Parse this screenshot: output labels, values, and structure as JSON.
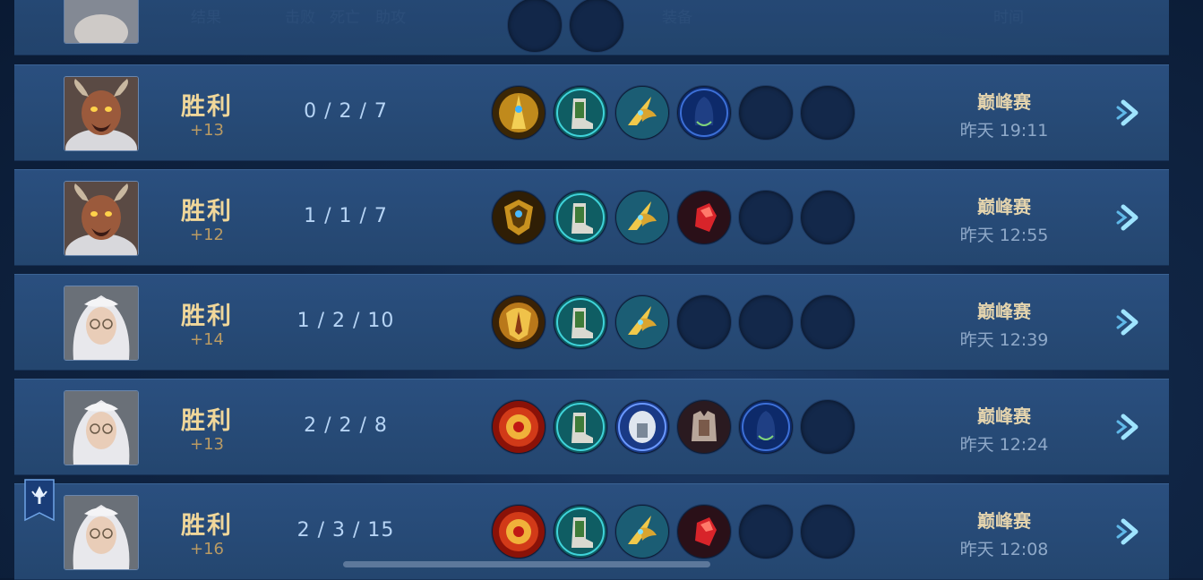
{
  "header": {
    "result": "结果",
    "kills": "击败",
    "deaths": "死亡",
    "assists": "助攻",
    "equipment": "装备",
    "time": "时间"
  },
  "matches": [
    {
      "hero": "horned-warrior",
      "result": "胜利",
      "points": "+13",
      "kda": "0 / 2 / 7",
      "items": [
        "gold-staff",
        "boots",
        "gold-wing-blade",
        "blue-cloak",
        "empty",
        "empty"
      ],
      "mode": "巅峰赛",
      "time": "昨天 19:11"
    },
    {
      "hero": "horned-warrior",
      "result": "胜利",
      "points": "+12",
      "kda": "1 / 1 / 7",
      "items": [
        "gold-shield",
        "boots",
        "gold-wing-blade",
        "red-gem",
        "empty",
        "empty"
      ],
      "mode": "巅峰赛",
      "time": "昨天 12:55"
    },
    {
      "hero": "silver-haired-mage",
      "result": "胜利",
      "points": "+14",
      "kda": "1 / 2 / 10",
      "items": [
        "gold-crest",
        "boots",
        "gold-wing-blade",
        "empty",
        "empty",
        "empty"
      ],
      "mode": "巅峰赛",
      "time": "昨天 12:39"
    },
    {
      "hero": "silver-haired-mage",
      "result": "胜利",
      "points": "+13",
      "kda": "2 / 2 / 8",
      "items": [
        "red-gold-medallion",
        "boots",
        "silver-helm",
        "armor-vest",
        "blue-cloak",
        "empty"
      ],
      "mode": "巅峰赛",
      "time": "昨天 12:24"
    },
    {
      "hero": "silver-haired-mage",
      "result": "胜利",
      "points": "+16",
      "kda": "2 / 3 / 15",
      "items": [
        "red-gold-medallion",
        "boots",
        "gold-wing-blade",
        "red-gem",
        "empty",
        "empty"
      ],
      "mode": "巅峰赛",
      "time": "昨天 12:08"
    }
  ],
  "icons": {
    "arrow": "chevron-right-icon",
    "badge": "rank-banner-icon"
  },
  "colors": {
    "result_gold": "#f0d79a",
    "kda_blue": "#b6d4f5",
    "row_bg": "#2a4f7f"
  }
}
